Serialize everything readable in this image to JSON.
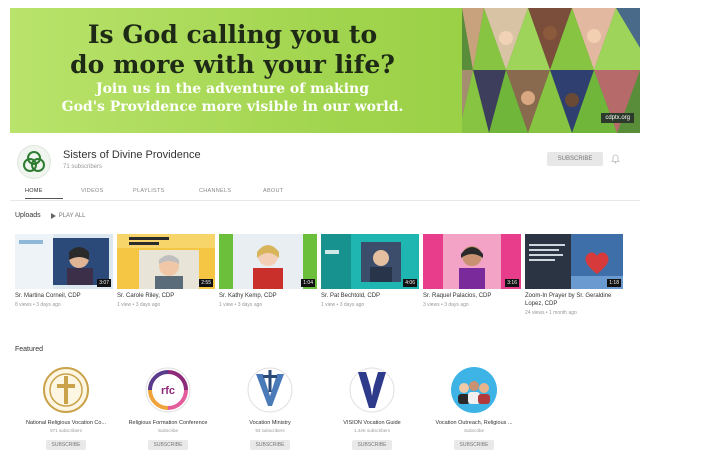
{
  "banner": {
    "title_line1": "Is God calling you to",
    "title_line2": "do more with your life?",
    "sub_line1": "Join us in the adventure of making",
    "sub_line2": "God's Providence more visible in our world.",
    "tag": "cdptx.org"
  },
  "channel": {
    "name": "Sisters of Divine Providence",
    "subscribers": "71 subscribers",
    "subscribe_label": "SUBSCRIBE"
  },
  "tabs": [
    "HOME",
    "VIDEOS",
    "PLAYLISTS",
    "CHANNELS",
    "ABOUT"
  ],
  "uploads": {
    "title": "Uploads",
    "play_all": "PLAY ALL",
    "videos": [
      {
        "title": "Sr. Martina Corneil, CDP",
        "meta": "8 views • 3 days ago",
        "duration": "3:07"
      },
      {
        "title": "Sr. Carole Riley, CDP",
        "meta": "1 view • 3 days ago",
        "duration": "2:55"
      },
      {
        "title": "Sr. Kathy Kemp, CDP",
        "meta": "1 view • 3 days ago",
        "duration": "1:04"
      },
      {
        "title": "Sr. Pat Bechtold, CDP",
        "meta": "1 view • 3 days ago",
        "duration": "4:06"
      },
      {
        "title": "Sr. Raquel Palacios, CDP",
        "meta": "3 views • 3 days ago",
        "duration": "3:16"
      },
      {
        "title": "Zoom-In Prayer by Sr. Geraldine Lopez, CDP",
        "meta": "24 views • 1 month ago",
        "duration": "1:18"
      }
    ]
  },
  "featured": {
    "title": "Featured",
    "channels": [
      {
        "name": "National Religious Vocation Co...",
        "subs": "971 subscribers",
        "button": "SUBSCRIBE"
      },
      {
        "name": "Religious Formation Conference",
        "subs": "Subscribe",
        "button": "SUBSCRIBE"
      },
      {
        "name": "Vocation Ministry",
        "subs": "93 subscribers",
        "button": "SUBSCRIBE"
      },
      {
        "name": "VISION Vocation Guide",
        "subs": "1.44K subscribers",
        "button": "SUBSCRIBE"
      },
      {
        "name": "Vocation Outreach, Religious ...",
        "subs": "Subscribe",
        "button": "SUBSCRIBE"
      }
    ]
  },
  "colors": {
    "banner_green": "#a2d54f",
    "banner_dark": "#1e2a16",
    "logo_green": "#2e7d32"
  }
}
